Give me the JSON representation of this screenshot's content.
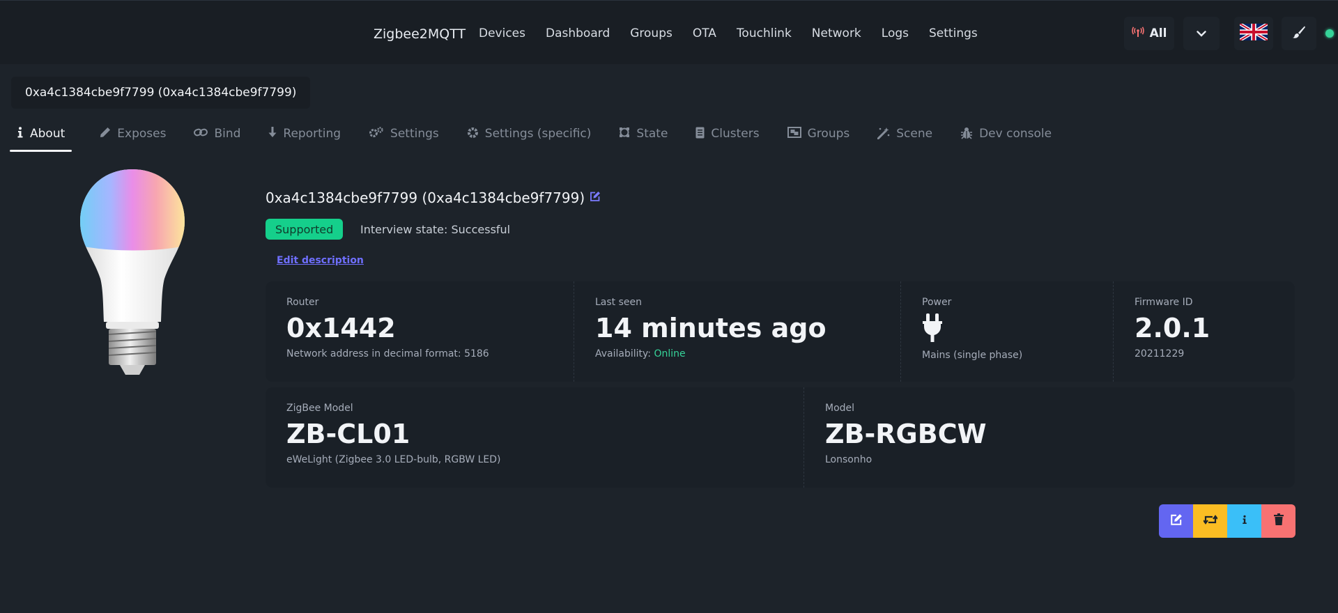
{
  "navbar": {
    "brand": "Zigbee2MQTT",
    "links": [
      "Devices",
      "Dashboard",
      "Groups",
      "OTA",
      "Touchlink",
      "Network",
      "Logs",
      "Settings"
    ],
    "filter_label": "All",
    "icons": {
      "filter": "antenna-icon",
      "dropdown": "chevron-down-icon",
      "language": "uk-flag-icon",
      "theme": "paint-brush-icon",
      "connection": "status-dot"
    }
  },
  "device_tab": {
    "title": "0xa4c1384cbe9f7799 (0xa4c1384cbe9f7799)"
  },
  "subtabs": [
    {
      "label": "About",
      "icon": "info-icon",
      "active": true
    },
    {
      "label": "Exposes",
      "icon": "pencil-icon"
    },
    {
      "label": "Bind",
      "icon": "link-icon"
    },
    {
      "label": "Reporting",
      "icon": "download-arrow-icon"
    },
    {
      "label": "Settings",
      "icon": "gears-icon"
    },
    {
      "label": "Settings (specific)",
      "icon": "gear-icon"
    },
    {
      "label": "State",
      "icon": "state-icon"
    },
    {
      "label": "Clusters",
      "icon": "clusters-icon"
    },
    {
      "label": "Groups",
      "icon": "groups-icon"
    },
    {
      "label": "Scene",
      "icon": "magic-wand-icon"
    },
    {
      "label": "Dev console",
      "icon": "bug-icon"
    }
  ],
  "device": {
    "name": "0xa4c1384cbe9f7799 (0xa4c1384cbe9f7799)",
    "supported_badge": "Supported",
    "interview_state": "Interview state: Successful",
    "edit_description": "Edit description"
  },
  "stats_row1": [
    {
      "title": "Router",
      "value": "0x1442",
      "desc": "Network address in decimal format: 5186"
    },
    {
      "title": "Last seen",
      "value": "14 minutes ago",
      "desc_prefix": "Availability: ",
      "desc_value": "Online"
    },
    {
      "title": "Power",
      "icon": "plug-icon",
      "desc": "Mains (single phase)"
    },
    {
      "title": "Firmware ID",
      "value": "2.0.1",
      "desc": "20211229"
    }
  ],
  "stats_row2": [
    {
      "title": "ZigBee Model",
      "value": "ZB-CL01",
      "desc": "eWeLight (Zigbee 3.0 LED-bulb, RGBW LED)"
    },
    {
      "title": "Model",
      "value": "ZB-RGBCW",
      "desc": "Lonsonho"
    }
  ],
  "actions": [
    {
      "name": "edit",
      "icon": "edit-icon",
      "color": "#6366f1"
    },
    {
      "name": "reconfigure",
      "icon": "retweet-icon",
      "color": "#fbbd23"
    },
    {
      "name": "interview",
      "icon": "info-icon",
      "color": "#3abff8"
    },
    {
      "name": "remove",
      "icon": "trash-icon",
      "color": "#f87272"
    }
  ],
  "colors": {
    "background": "#1d232a",
    "navbar": "#191e24",
    "success": "#15cf8b",
    "online": "#36d399",
    "accent": "#6f6fff"
  }
}
